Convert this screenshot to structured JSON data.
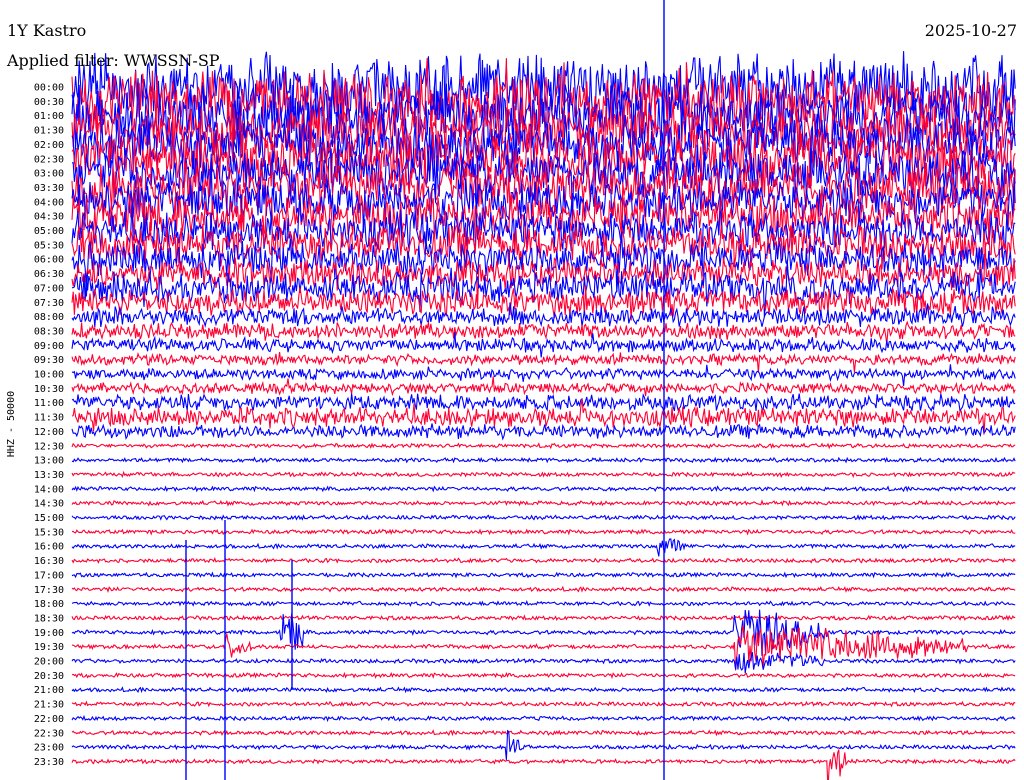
{
  "header": {
    "station": "1Y Kastro",
    "date": "2025-10-27",
    "filter": "Applied filter: WWSSN-SP"
  },
  "chart_data": {
    "type": "line",
    "title": "1Y Kastro",
    "ylabel": "HHZ - 50000",
    "tick_labels": [
      "00:00",
      "00:30",
      "01:00",
      "01:30",
      "02:00",
      "02:30",
      "03:00",
      "03:30",
      "04:00",
      "04:30",
      "05:00",
      "05:30",
      "06:00",
      "06:30",
      "07:00",
      "07:30",
      "08:00",
      "08:30",
      "09:00",
      "09:30",
      "10:00",
      "10:30",
      "11:00",
      "11:30",
      "12:00",
      "12:30",
      "13:00",
      "13:30",
      "14:00",
      "14:30",
      "15:00",
      "15:30",
      "16:00",
      "16:30",
      "17:00",
      "17:30",
      "18:00",
      "18:30",
      "19:00",
      "19:30",
      "20:00",
      "20:30",
      "21:00",
      "21:30",
      "22:00",
      "22:30",
      "23:00",
      "23:30"
    ],
    "series_colors": [
      "#0000ff",
      "#ff0033"
    ],
    "trace_noise_level": [
      1.0,
      0.95,
      0.95,
      0.9,
      0.9,
      0.9,
      0.85,
      0.85,
      0.8,
      0.8,
      0.75,
      0.75,
      0.7,
      0.65,
      0.65,
      0.6,
      0.5,
      0.45,
      0.4,
      0.35,
      0.35,
      0.35,
      0.45,
      0.5,
      0.4,
      0.12,
      0.12,
      0.1,
      0.1,
      0.1,
      0.09,
      0.08,
      0.08,
      0.08,
      0.08,
      0.08,
      0.08,
      0.08,
      0.08,
      0.08,
      0.08,
      0.08,
      0.08,
      0.08,
      0.07,
      0.07,
      0.07,
      0.07
    ],
    "events": [
      {
        "row": 38,
        "time_frac": 0.7,
        "duration_frac": 0.1,
        "amplitude": 1.2
      },
      {
        "row": 39,
        "time_frac": 0.7,
        "duration_frac": 0.25,
        "amplitude": 1.0
      },
      {
        "row": 40,
        "time_frac": 0.7,
        "duration_frac": 0.1,
        "amplitude": 0.6
      },
      {
        "row": 39,
        "time_frac": 0.16,
        "duration_frac": 0.03,
        "amplitude": 0.7
      },
      {
        "row": 38,
        "time_frac": 0.22,
        "duration_frac": 0.015,
        "amplitude": 1.1
      },
      {
        "row": 38,
        "time_frac": 0.23,
        "duration_frac": 0.015,
        "amplitude": 1.6
      },
      {
        "row": 46,
        "time_frac": 0.46,
        "duration_frac": 0.02,
        "amplitude": 0.7
      },
      {
        "row": 47,
        "time_frac": 0.8,
        "duration_frac": 0.02,
        "amplitude": 1.2
      },
      {
        "row": 32,
        "time_frac": 0.62,
        "duration_frac": 0.03,
        "amplitude": 0.6
      }
    ]
  }
}
